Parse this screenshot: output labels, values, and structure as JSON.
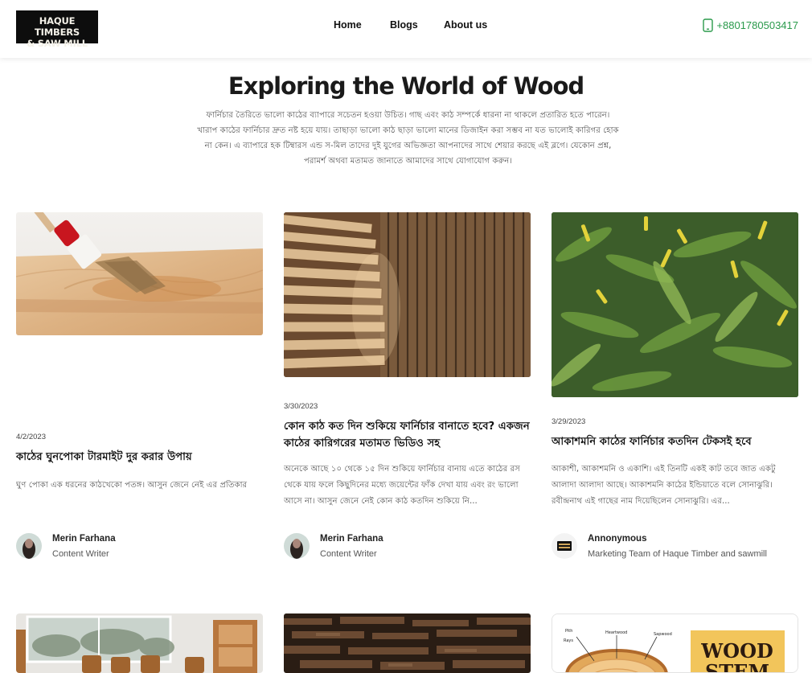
{
  "header": {
    "logo_line1": "HAQUE TIMBERS",
    "logo_line2": "& SAW MILL",
    "nav": {
      "home": "Home",
      "blogs": "Blogs",
      "about": "About us"
    },
    "phone": "+8801780503417",
    "phone_color": "#2a9a4b"
  },
  "hero": {
    "title": "Exploring the World of Wood",
    "description": "ফার্নিচার তৈরিতে ভালো কাঠের ব্যাপারে সচেতন হওয়া উচিত। গাছ এবং কাঠ সম্পর্কে ধারনা না থাকলে প্রতারিত হতে পারেন। খারাপ কাঠের ফার্নিচার দ্রুত নষ্ট হয়ে যায়। তাছাড়া ভালো কাঠ ছাড়া ভালো মানের ডিজাইন করা সম্ভব না যত ভালোই কারিগর হোক না কেন। এ ব্যাপারে হক টিম্বারস এন্ড স-মিল তাদের দুই যুগের অভিজ্ঞতা আপনাদের সাথে শেয়ার করছে এই ব্লগে। যেকোন প্রশ্ন, পরামর্শ অথবা মতামত জানাতে আমাদের সাথে যোগাযোগ করুন।"
  },
  "posts": [
    {
      "date": "4/2/2023",
      "title": "কাঠের ঘুনপোকা টারমাইট দুর করার উপায়",
      "excerpt": "ঘুণ পোকা এক ধরনের কাঠখেকো পতঙ্গ। আসুন জেনে নেই এর প্রতিকার",
      "author_name": "Merin Farhana",
      "author_role": "Content Writer",
      "image": "paintbrush-on-wood"
    },
    {
      "date": "3/30/2023",
      "title": "কোন কাঠ কত দিন শুকিয়ে ফার্নিচার বানাতে হবে? একজন কাঠের কারিগরের মতামত ভিডিও সহ",
      "excerpt": "অনেকে আছে ১০ থেকে ১৫ দিন শুকিয়ে ফার্নিচার বানায় এতে কাঠের রস থেকে যায় ফলে কিছুদিনের মধ্যে জয়েন্টের ফাঁক দেখা যায় এবং রং ভালো আসে না। আসুন জেনে নেই কোন কাঠ কতদিন শুকিয়ে নি...",
      "author_name": "Merin Farhana",
      "author_role": "Content Writer",
      "image": "stacked-lumber"
    },
    {
      "date": "3/29/2023",
      "title": "আকাশমনি কাঠের ফার্নিচার কতদিন টেকসই হবে",
      "excerpt": "আকাশী, আকাশমনি ও  একাশি। এই তিনটি একই কাট তবে জাত একটু আলাদা আলাদা আছে।  আকাশমনি কাঠের ইন্ডিয়াতে বলে সোনাঝুরি। রবীন্দ্রনাথ এই গাছের নাম দিয়েছিলেন সোনাঝুরি। এর...",
      "author_name": "Annonymous",
      "author_role": "Marketing Team of Haque Timber and sawmill",
      "image": "acacia-leaves"
    }
  ],
  "bottom_cards": [
    {
      "image": "dining-room"
    },
    {
      "image": "dark-lumber-stack"
    },
    {
      "image": "wood-stem-diagram",
      "label_pith": "Pith",
      "label_heartwood": "Heartwood",
      "label_sapwood": "Sapwood",
      "label_rays": "Rays",
      "label_big": "WOOD",
      "label_big2": "STEM"
    }
  ]
}
